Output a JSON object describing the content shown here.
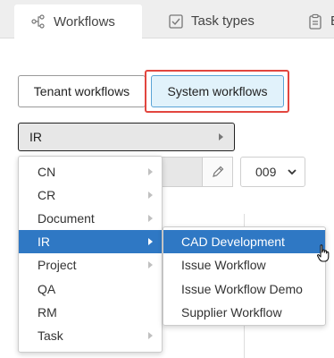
{
  "tabs": [
    {
      "label": "Workflows",
      "icon": "workflow-icon",
      "active": true
    },
    {
      "label": "Task types",
      "icon": "checkbox-icon",
      "active": false
    },
    {
      "label": "B",
      "icon": "clipboard-icon",
      "active": false
    }
  ],
  "scope_toggle": {
    "tenant_label": "Tenant workflows",
    "system_label": "System workflows",
    "selected": "System workflows"
  },
  "category_select": {
    "value": "IR"
  },
  "version_select": {
    "value": "009"
  },
  "menu": {
    "items": [
      {
        "label": "CN",
        "has_submenu": true
      },
      {
        "label": "CR",
        "has_submenu": true
      },
      {
        "label": "Document",
        "has_submenu": true
      },
      {
        "label": "IR",
        "has_submenu": true,
        "active": true
      },
      {
        "label": "Project",
        "has_submenu": true
      },
      {
        "label": "QA",
        "has_submenu": false
      },
      {
        "label": "RM",
        "has_submenu": false
      },
      {
        "label": "Task",
        "has_submenu": true
      }
    ]
  },
  "submenu": {
    "items": [
      {
        "label": "CAD Development",
        "active": true
      },
      {
        "label": "Issue Workflow"
      },
      {
        "label": "Issue Workflow Demo"
      },
      {
        "label": "Supplier Workflow"
      }
    ]
  },
  "colors": {
    "accent": "#2f78c4",
    "highlight_border": "#e2463f",
    "selected_toggle_bg": "#e1f2fb"
  }
}
